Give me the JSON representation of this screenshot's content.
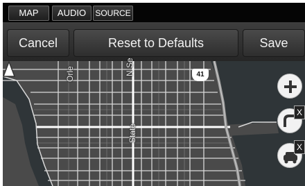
{
  "tabs": {
    "map": "MAP",
    "audio": "AUDIO",
    "source": "SOURCE"
  },
  "actions": {
    "cancel": "Cancel",
    "reset": "Reset to Defaults",
    "save": "Save"
  },
  "map": {
    "street_labels": [
      "Orle",
      "N Se",
      "State"
    ],
    "route_shield": "41",
    "badge_close": "X"
  },
  "icons": {
    "vehicle": "triangle-arrow-icon",
    "zoom": "plus-icon",
    "detour": "detour-icon",
    "traffic": "traffic-icon"
  },
  "colors": {
    "water": "#2f3538",
    "land": "#4a4a4a",
    "road": "#d9d9d9",
    "highway": "#9a9a9a"
  }
}
